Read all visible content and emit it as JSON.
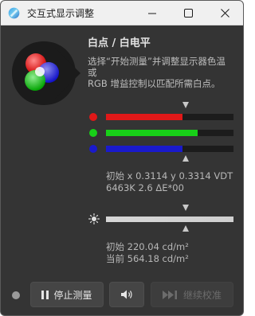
{
  "window": {
    "title": "交互式显示调整",
    "controls": {
      "minimize": "minimize-icon",
      "maximize": "maximize-icon",
      "close": "close-icon"
    }
  },
  "panel": {
    "heading": "白点 / 白电平",
    "description_lines": [
      "选择“开始测量”并调整显示器色温",
      "或",
      "RGB 增益控制以匹配所需白点。"
    ]
  },
  "rgb": {
    "channels": [
      {
        "name": "red",
        "color": "#e01818",
        "level": 0.6
      },
      {
        "name": "green",
        "color": "#18d018",
        "level": 0.72
      },
      {
        "name": "blue",
        "color": "#1a1acc",
        "level": 0.6
      }
    ],
    "target_fraction": 0.62
  },
  "white_point": {
    "line1": "初始 x 0.3114 y 0.3314 VDT",
    "line2": "6463K 2.6 ΔE*00"
  },
  "luminance": {
    "level": 1.0,
    "target_fraction": 0.62,
    "line1": "初始 220.04 cd/m²",
    "line2": "当前 564.18 cd/m²"
  },
  "buttons": {
    "stop_label": "停止测量",
    "continue_label": "继续校准"
  },
  "colors": {
    "background": "#343434",
    "title_bar": "#f0f0f0"
  }
}
